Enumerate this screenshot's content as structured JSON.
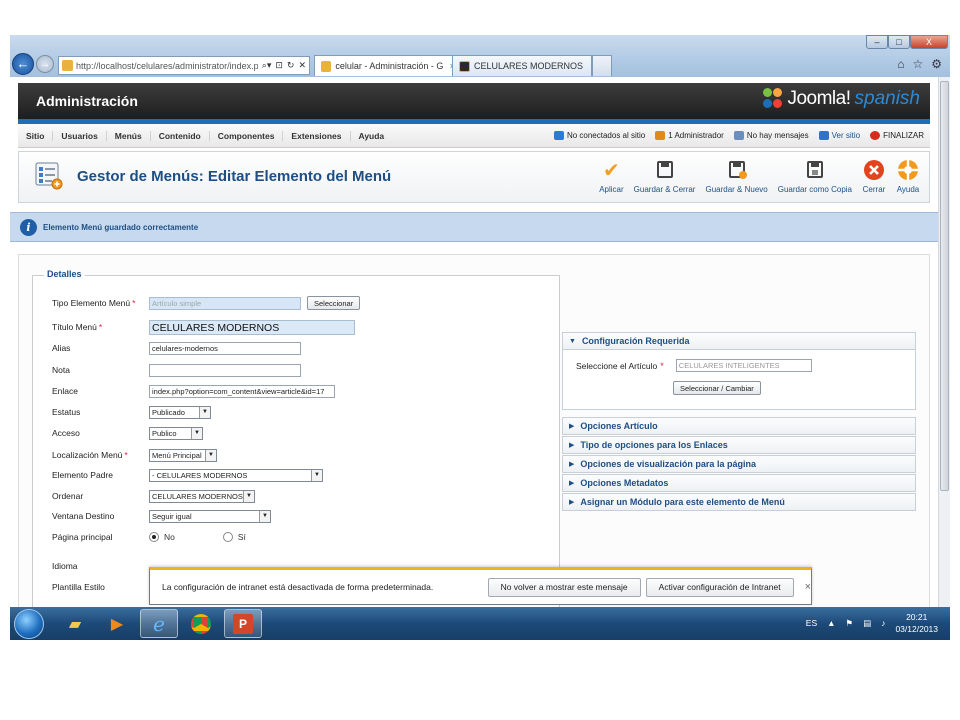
{
  "browser": {
    "url": "http://localhost/celulares/administrator/index.p",
    "url_host": "localhost",
    "tabs": [
      {
        "label": "celular - Administración - G...",
        "close": "×"
      },
      {
        "label": "CELULARES MODERNOS"
      }
    ],
    "window_controls": [
      "–",
      "□",
      "X"
    ]
  },
  "header": {
    "title": "Administración",
    "logo_word": "Joomla!",
    "logo_suffix": "spanish"
  },
  "menu": {
    "items": [
      "Sitio",
      "Usuarios",
      "Menús",
      "Contenido",
      "Componentes",
      "Extensiones",
      "Ayuda"
    ],
    "status": [
      {
        "label": "No conectados al sitio",
        "icon": "users-icon",
        "color": "#2b7bd3"
      },
      {
        "label": "1 Administrador",
        "icon": "admin-icon",
        "color": "#e08a1c"
      },
      {
        "label": "No hay mensajes",
        "icon": "mail-icon",
        "color": "#6a8fbd"
      },
      {
        "label": "Ver sitio",
        "icon": "monitor-icon",
        "color": "#2f73c4"
      },
      {
        "label": "FINALIZAR",
        "icon": "power-icon",
        "color": "#d32d1c"
      }
    ]
  },
  "toolbar": {
    "page_title": "Gestor de Menús: Editar Elemento del Menú",
    "buttons": [
      {
        "label": "Aplicar",
        "icon": "check-icon"
      },
      {
        "label": "Guardar & Cerrar",
        "icon": "save-close-icon"
      },
      {
        "label": "Guardar & Nuevo",
        "icon": "save-new-icon"
      },
      {
        "label": "Guardar como Copia",
        "icon": "save-copy-icon"
      },
      {
        "label": "Cerrar",
        "icon": "close-icon"
      },
      {
        "label": "Ayuda",
        "icon": "help-icon"
      }
    ]
  },
  "message": {
    "text": "Elemento Menú guardado correctamente"
  },
  "details": {
    "legend": "Detalles",
    "tipo_label": "Tipo Elemento Menú",
    "tipo_value": "Artículo simple",
    "select_button": "Seleccionar",
    "titulo_label": "Título Menú",
    "titulo_value": "CELULARES MODERNOS",
    "alias_label": "Alias",
    "alias_value": "celulares-modernos",
    "nota_label": "Nota",
    "nota_value": "",
    "enlace_label": "Enlace",
    "enlace_value": "index.php?option=com_content&view=article&id=17",
    "estatus_label": "Estatus",
    "estatus_value": "Publicado",
    "acceso_label": "Acceso",
    "acceso_value": "Publico",
    "localizacion_label": "Localización Menú",
    "localizacion_value": "Menú Principal",
    "padre_label": "Elemento Padre",
    "padre_value": "- CELULARES MODERNOS",
    "ordenar_label": "Ordenar",
    "ordenar_value": "CELULARES MODERNOS",
    "ventana_label": "Ventana Destino",
    "ventana_value": "Seguir igual",
    "principal_label": "Página principal",
    "principal_no": "No",
    "principal_si": "Sí",
    "idioma_label": "Idioma",
    "plantilla_label": "Plantilla Estilo",
    "required_mark": "*"
  },
  "right_panel": {
    "config_title": "Configuración Requerida",
    "articulo_label": "Seleccione el Artículo",
    "articulo_value": "CELULARES INTELIGENTES",
    "change_button": "Seleccionar / Cambiar",
    "sections": [
      "Opciones Artículo",
      "Tipo de opciones para los Enlaces",
      "Opciones de visualización para la página",
      "Opciones Metadatos",
      "Asignar un Módulo para este elemento de Menú"
    ]
  },
  "notification": {
    "text": "La configuración de intranet está desactivada de forma predeterminada.",
    "dismiss_button": "No volver a mostrar este mensaje",
    "enable_button": "Activar configuración de Intranet",
    "close": "×"
  },
  "taskbar": {
    "language": "ES",
    "time": "20:21",
    "date": "03/12/2013"
  }
}
